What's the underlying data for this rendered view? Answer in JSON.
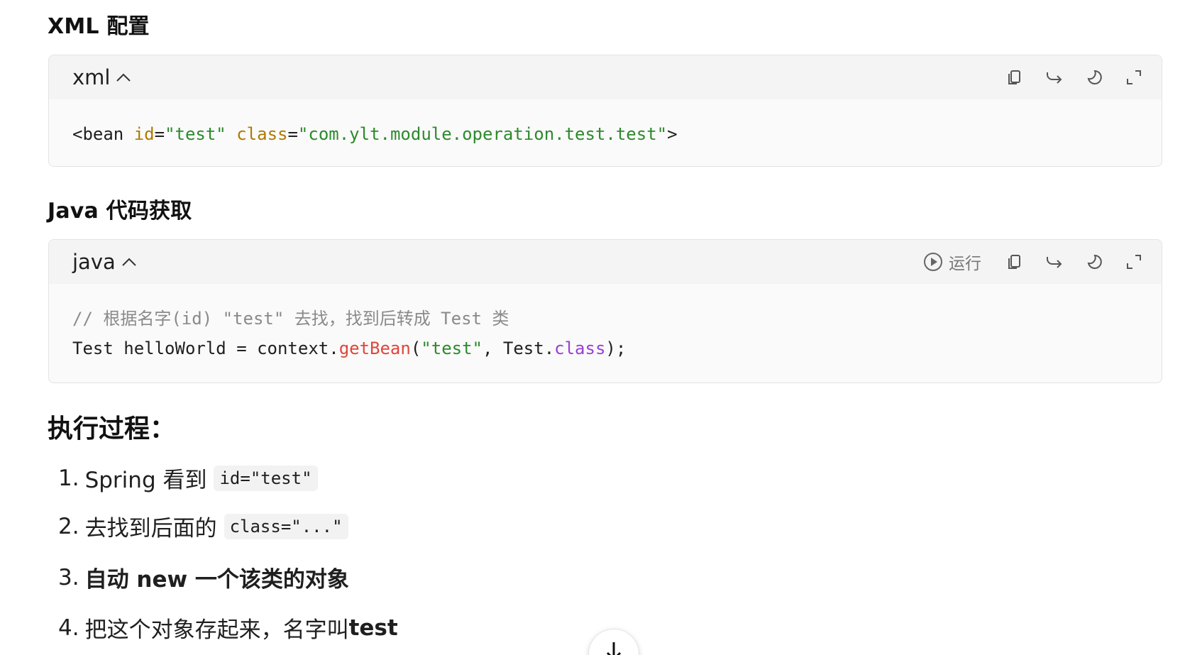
{
  "sections": {
    "xml_heading": "XML 配置",
    "java_heading": "Java 代码获取",
    "process_heading": "执行过程："
  },
  "xml_block": {
    "lang": "xml",
    "line1": {
      "t1": "<bean ",
      "attr1": "id",
      "eq1": "=",
      "str1": "\"test\"",
      "sp": " ",
      "attr2": "class",
      "eq2": "=",
      "str2": "\"com.ylt.module.operation.test.test\"",
      "close": ">"
    }
  },
  "java_block": {
    "lang": "java",
    "run_label": "运行",
    "comment": "// 根据名字(id) \"test\" 去找，找到后转成 Test 类",
    "line2": {
      "t1": "Test helloWorld = context.",
      "fn": "getBean",
      "p1": "(",
      "str": "\"test\"",
      "p2": ", Test.",
      "kw": "class",
      "p3": ");"
    }
  },
  "steps": [
    {
      "num": "1.",
      "text": "Spring 看到",
      "code": "id=\"test\""
    },
    {
      "num": "2.",
      "text": "去找到后面的",
      "code": "class=\"...\""
    },
    {
      "num": "3.",
      "text": "自动 new 一个该类的对象"
    },
    {
      "num": "4.",
      "text": "把这个对象存起来，名字叫 ",
      "bold": "test"
    }
  ],
  "icons": {
    "copy": "copy-icon",
    "share": "share-icon",
    "theme": "moon-icon",
    "expand": "expand-icon",
    "run": "play-circle-icon",
    "collapse": "chevron-up-icon",
    "scroll": "arrow-down-icon"
  }
}
